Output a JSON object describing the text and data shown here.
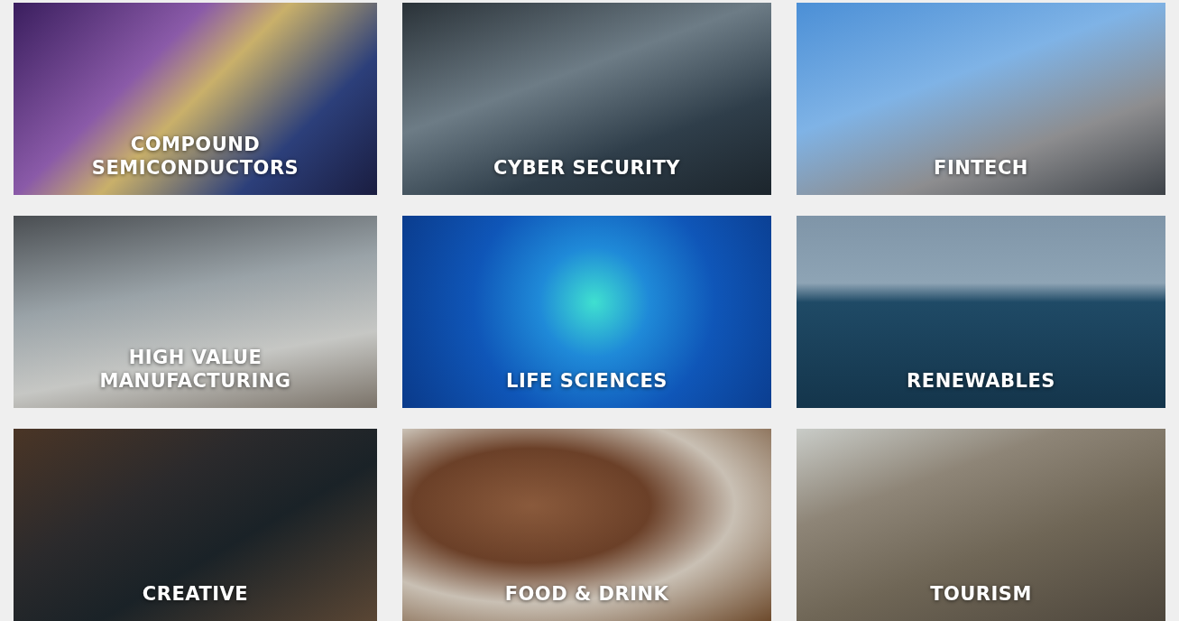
{
  "tiles": [
    {
      "label": "COMPOUND SEMICONDUCTORS"
    },
    {
      "label": "CYBER SECURITY"
    },
    {
      "label": "FINTECH"
    },
    {
      "label": "HIGH VALUE MANUFACTURING"
    },
    {
      "label": "LIFE SCIENCES"
    },
    {
      "label": "RENEWABLES"
    },
    {
      "label": "CREATIVE"
    },
    {
      "label": "FOOD & DRINK"
    },
    {
      "label": "TOURISM"
    }
  ]
}
